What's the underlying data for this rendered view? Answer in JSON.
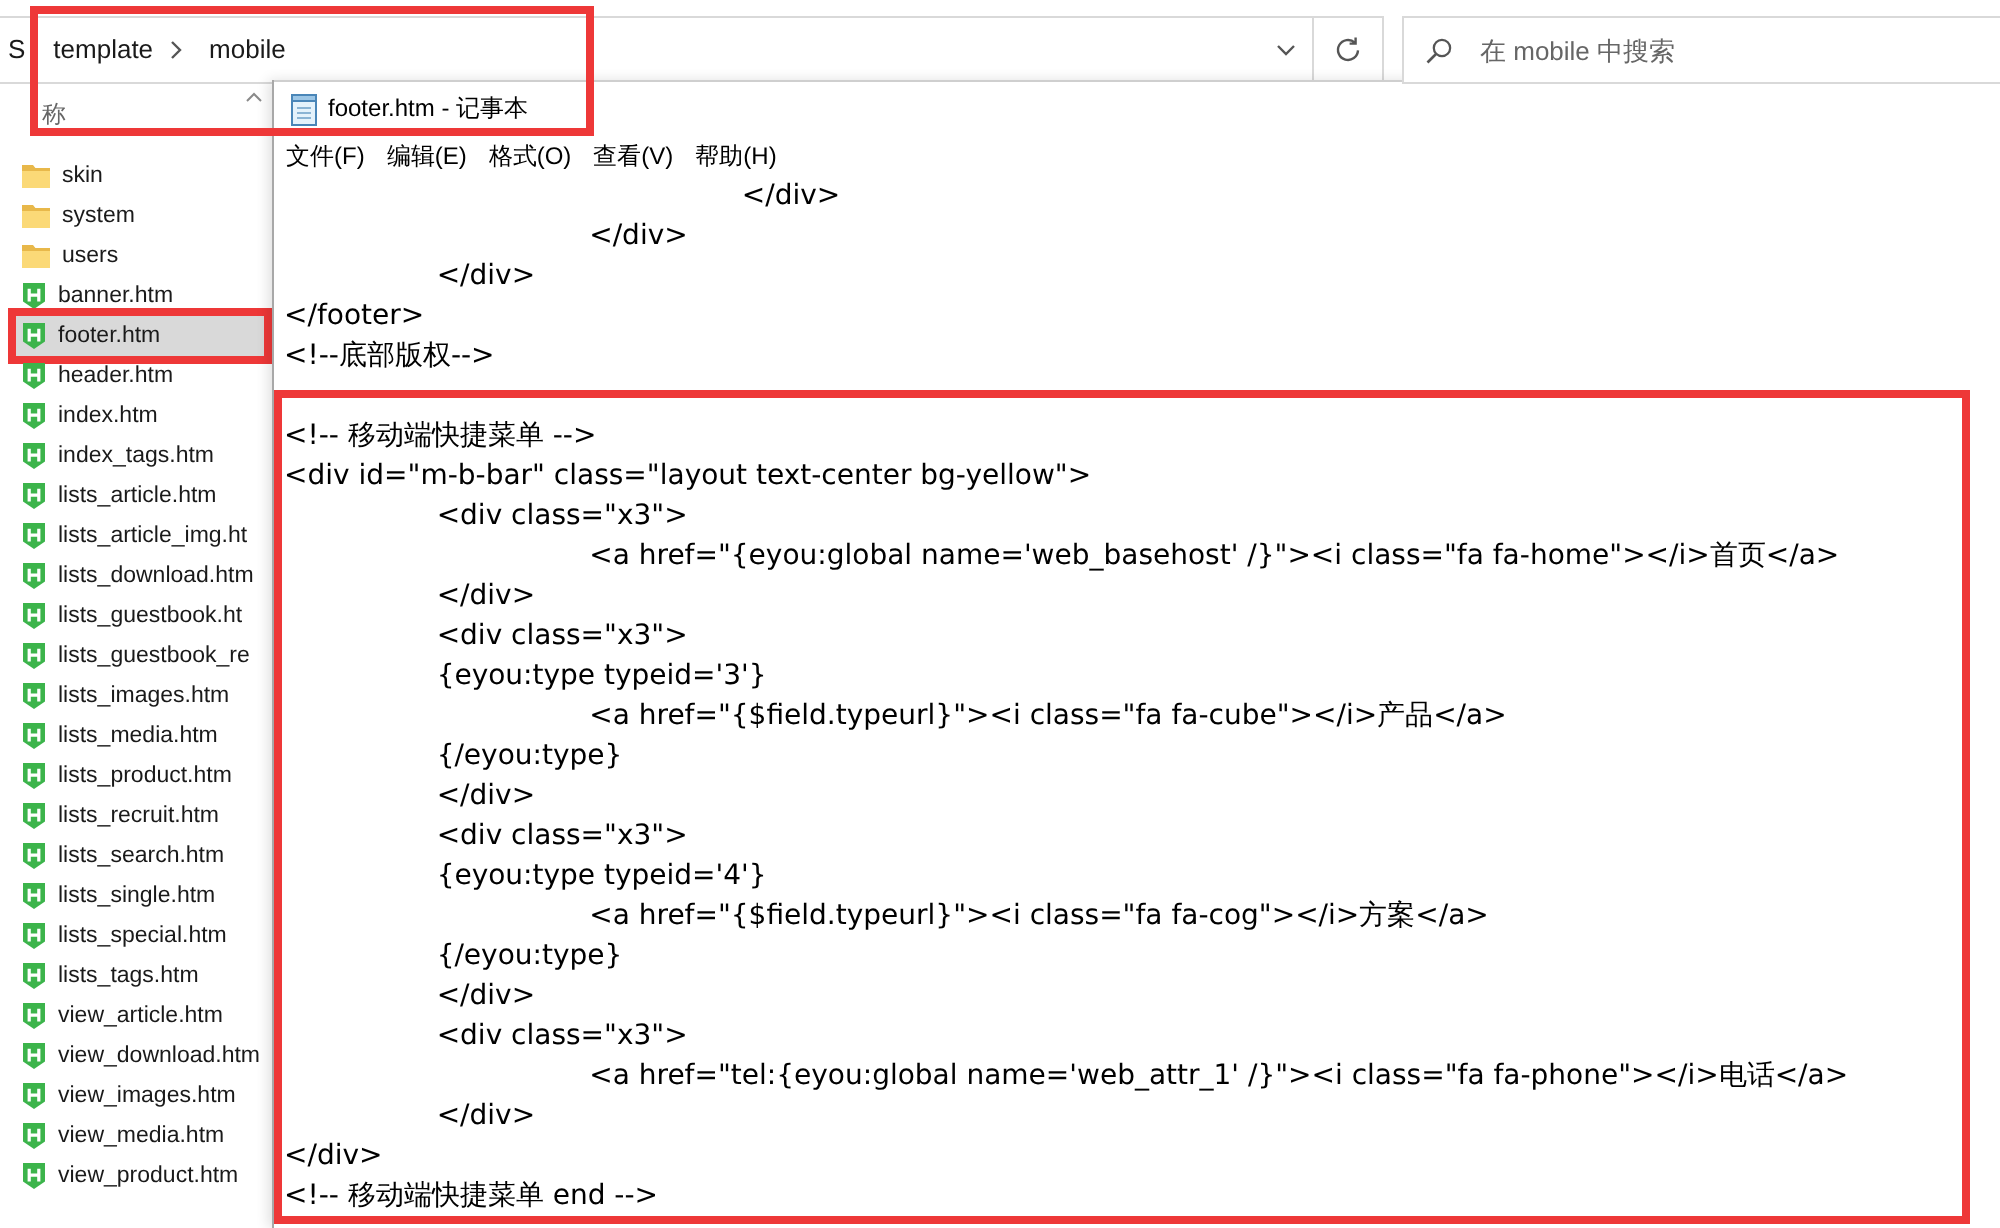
{
  "explorer": {
    "address_bar": {
      "marked": true,
      "crumbs": [
        {
          "text": "S",
          "chevron_after": false
        },
        {
          "text": "template",
          "chevron_after": true
        },
        {
          "text": "mobile",
          "chevron_after": false
        }
      ]
    },
    "search": {
      "placeholder": "在 mobile 中搜索"
    },
    "column_header": "称",
    "files": [
      {
        "name": "skin",
        "kind": "folder",
        "selected": false,
        "marked": false
      },
      {
        "name": "system",
        "kind": "folder",
        "selected": false,
        "marked": false
      },
      {
        "name": "users",
        "kind": "folder",
        "selected": false,
        "marked": false
      },
      {
        "name": "banner.htm",
        "kind": "html",
        "selected": false,
        "marked": false
      },
      {
        "name": "footer.htm",
        "kind": "html",
        "selected": true,
        "marked": true
      },
      {
        "name": "header.htm",
        "kind": "html",
        "selected": false,
        "marked": false
      },
      {
        "name": "index.htm",
        "kind": "html",
        "selected": false,
        "marked": false
      },
      {
        "name": "index_tags.htm",
        "kind": "html",
        "selected": false,
        "marked": false
      },
      {
        "name": "lists_article.htm",
        "kind": "html",
        "selected": false,
        "marked": false
      },
      {
        "name": "lists_article_img.ht",
        "kind": "html",
        "selected": false,
        "marked": false
      },
      {
        "name": "lists_download.htm",
        "kind": "html",
        "selected": false,
        "marked": false
      },
      {
        "name": "lists_guestbook.ht",
        "kind": "html",
        "selected": false,
        "marked": false
      },
      {
        "name": "lists_guestbook_re",
        "kind": "html",
        "selected": false,
        "marked": false
      },
      {
        "name": "lists_images.htm",
        "kind": "html",
        "selected": false,
        "marked": false
      },
      {
        "name": "lists_media.htm",
        "kind": "html",
        "selected": false,
        "marked": false
      },
      {
        "name": "lists_product.htm",
        "kind": "html",
        "selected": false,
        "marked": false
      },
      {
        "name": "lists_recruit.htm",
        "kind": "html",
        "selected": false,
        "marked": false
      },
      {
        "name": "lists_search.htm",
        "kind": "html",
        "selected": false,
        "marked": false
      },
      {
        "name": "lists_single.htm",
        "kind": "html",
        "selected": false,
        "marked": false
      },
      {
        "name": "lists_special.htm",
        "kind": "html",
        "selected": false,
        "marked": false
      },
      {
        "name": "lists_tags.htm",
        "kind": "html",
        "selected": false,
        "marked": false
      },
      {
        "name": "view_article.htm",
        "kind": "html",
        "selected": false,
        "marked": false
      },
      {
        "name": "view_download.htm",
        "kind": "html",
        "selected": false,
        "marked": false
      },
      {
        "name": "view_images.htm",
        "kind": "html",
        "selected": false,
        "marked": false
      },
      {
        "name": "view_media.htm",
        "kind": "html",
        "selected": false,
        "marked": false
      },
      {
        "name": "view_product.htm",
        "kind": "html",
        "selected": false,
        "marked": false
      }
    ]
  },
  "notepad": {
    "title": "footer.htm - 记事本",
    "menu": [
      "文件(F)",
      "编辑(E)",
      "格式(O)",
      "查看(V)",
      "帮助(H)"
    ],
    "sections": [
      {
        "marked": false,
        "lines": [
          "\t\t\t</div>",
          "\t\t</div>",
          "\t</div>",
          "</footer>",
          "<!--底部版权-->"
        ]
      },
      {
        "marked": true,
        "lines": [
          "<!-- 移动端快捷菜单 -->",
          "<div id=\"m-b-bar\" class=\"layout text-center bg-yellow\">",
          "\t<div class=\"x3\">",
          "\t\t<a href=\"{eyou:global name='web_basehost' /}\"><i class=\"fa fa-home\"></i>首页</a>",
          "\t</div>",
          "\t<div class=\"x3\">",
          "\t{eyou:type typeid='3'}",
          "\t\t<a href=\"{$field.typeurl}\"><i class=\"fa fa-cube\"></i>产品</a>",
          "\t{/eyou:type}",
          "\t</div>",
          "\t<div class=\"x3\">",
          "\t{eyou:type typeid='4'}",
          "\t\t<a href=\"{$field.typeurl}\"><i class=\"fa fa-cog\"></i>方案</a>",
          "\t{/eyou:type}",
          "\t</div>",
          "\t<div class=\"x3\">",
          "\t\t<a href=\"tel:{eyou:global name='web_attr_1' /}\"><i class=\"fa fa-phone\"></i>电话</a>",
          "\t</div>",
          "</div>",
          "<!-- 移动端快捷菜单 end -->"
        ]
      }
    ]
  }
}
